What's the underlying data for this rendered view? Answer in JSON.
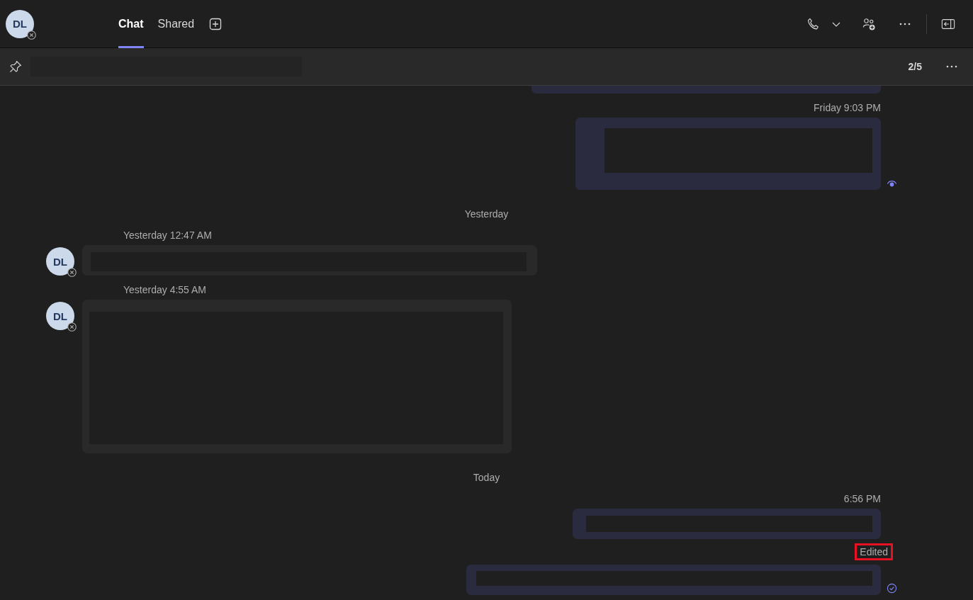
{
  "header": {
    "avatar": {
      "initials": "DL",
      "offline": true
    },
    "tabs": [
      {
        "label": "Chat",
        "selected": true
      },
      {
        "label": "Shared",
        "selected": false
      }
    ]
  },
  "pinned": {
    "counter": "2/5"
  },
  "feed": [
    {
      "kind": "outgoing",
      "seen": false,
      "sent": false
    },
    {
      "kind": "outgoing",
      "time": "Friday 9:03 PM",
      "seen": true,
      "sent": false
    },
    {
      "kind": "divider",
      "label": "Yesterday"
    },
    {
      "kind": "incoming",
      "initials": "DL",
      "offline": true,
      "time": "Yesterday 12:47 AM"
    },
    {
      "kind": "incoming",
      "initials": "DL",
      "offline": true,
      "time": "Yesterday 4:55 AM"
    },
    {
      "kind": "divider",
      "label": "Today"
    },
    {
      "kind": "outgoing",
      "time": "6:56 PM",
      "seen": false,
      "sent": false
    },
    {
      "kind": "outgoing",
      "edited": "Edited",
      "highlighted": true,
      "seen": false,
      "sent": true
    }
  ]
}
